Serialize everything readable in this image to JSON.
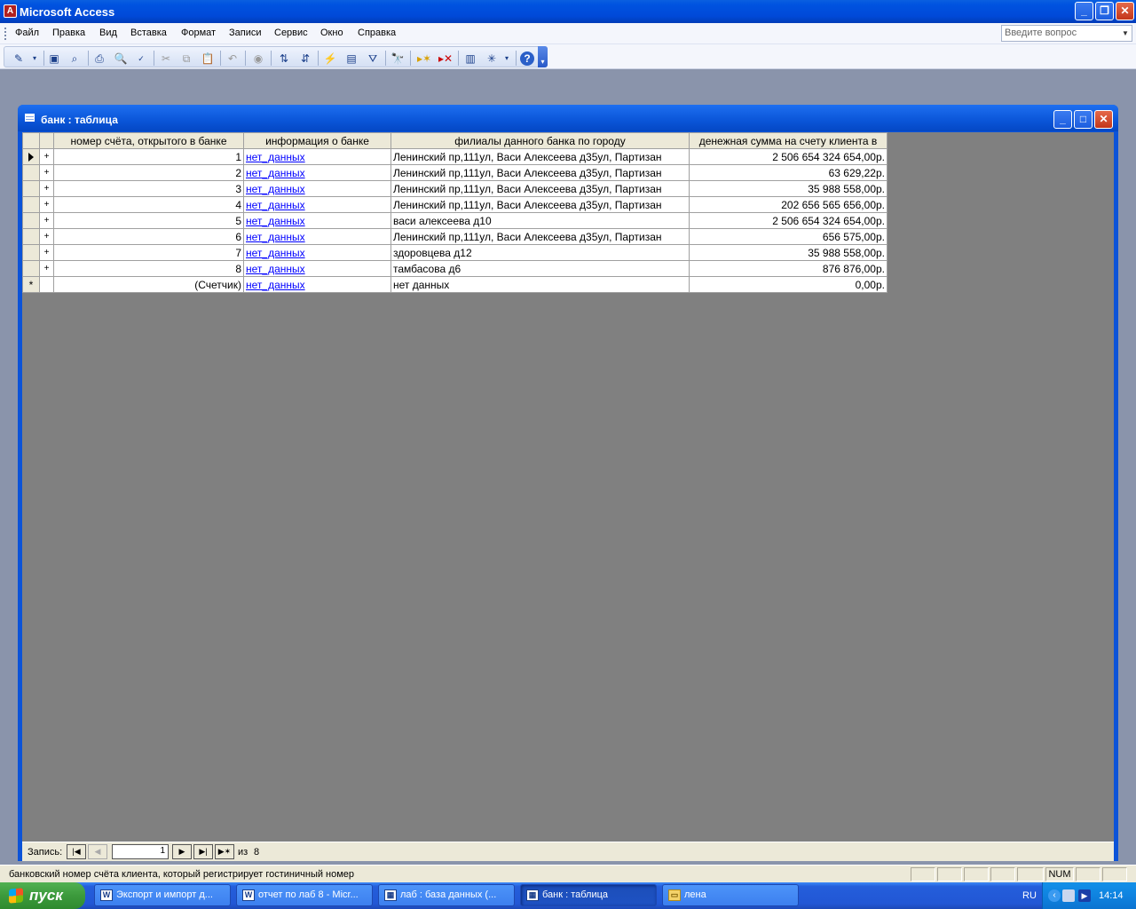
{
  "app": {
    "title": "Microsoft Access",
    "icon_glyph": "A"
  },
  "menubar": {
    "items": [
      "Файл",
      "Правка",
      "Вид",
      "Вставка",
      "Формат",
      "Записи",
      "Сервис",
      "Окно",
      "Справка"
    ],
    "help_placeholder": "Введите вопрос"
  },
  "toolbar": {
    "icons": [
      "view-icon",
      "save-icon",
      "search-files-icon",
      "print-icon",
      "print-preview-icon",
      "spelling-icon",
      "cut-icon",
      "copy-icon",
      "paste-icon",
      "undo-icon",
      "hyperlink-icon",
      "sort-ascending-icon",
      "sort-descending-icon",
      "filter-by-selection-icon",
      "filter-by-form-icon",
      "apply-filter-icon",
      "find-icon",
      "new-record-icon",
      "delete-record-icon",
      "database-window-icon",
      "new-object-icon",
      "help-icon"
    ]
  },
  "table_window": {
    "title": "банк : таблица",
    "columns": [
      "номер счёта, открытого в банке",
      "информация о банке",
      "филиалы данного банка по городу",
      "денежная сумма на счету клиента в"
    ],
    "rows": [
      {
        "num": "1",
        "info": "нет_данных",
        "branches": "Ленинский пр,111ул, Васи Алексеева д35ул, Партизан",
        "amount": "2 506 654 324 654,00р."
      },
      {
        "num": "2",
        "info": "нет_данных",
        "branches": "Ленинский пр,111ул, Васи Алексеева д35ул, Партизан",
        "amount": "63 629,22р."
      },
      {
        "num": "3",
        "info": "нет_данных",
        "branches": "Ленинский пр,111ул, Васи Алексеева д35ул, Партизан",
        "amount": "35 988 558,00р."
      },
      {
        "num": "4",
        "info": "нет_данных",
        "branches": "Ленинский пр,111ул, Васи Алексеева д35ул, Партизан",
        "amount": "202 656 565 656,00р."
      },
      {
        "num": "5",
        "info": "нет_данных",
        "branches": "васи алексеева д10",
        "amount": "2 506 654 324 654,00р."
      },
      {
        "num": "6",
        "info": "нет_данных",
        "branches": "Ленинский пр,111ул, Васи Алексеева д35ул, Партизан",
        "amount": "656 575,00р."
      },
      {
        "num": "7",
        "info": "нет_данных",
        "branches": "здоровцева д12",
        "amount": "35 988 558,00р."
      },
      {
        "num": "8",
        "info": "нет_данных",
        "branches": "тамбасова д6",
        "amount": "876 876,00р."
      }
    ],
    "new_row": {
      "num": "(Счетчик)",
      "info": "нет_данных",
      "branches": "нет данных",
      "amount": "0,00р."
    },
    "expand_glyph": "+",
    "new_row_glyph": "*"
  },
  "navigation": {
    "label": "Запись:",
    "current": "1",
    "of_label": "из",
    "total": "8"
  },
  "statusbar": {
    "text": "банковский номер счёта клиента, который регистрирует гостиничный номер",
    "num_indicator": "NUM"
  },
  "taskbar": {
    "start_label": "пуск",
    "tasks": [
      {
        "label": "Экспорт и импорт д...",
        "icon": "W"
      },
      {
        "label": "отчет по лаб 8 - Micr...",
        "icon": "W"
      },
      {
        "label": "лаб : база данных (...",
        "icon": "▦"
      },
      {
        "label": "банк : таблица",
        "icon": "▦"
      },
      {
        "label": "лена",
        "icon": "▭"
      }
    ],
    "language": "RU",
    "clock": "14:14"
  }
}
